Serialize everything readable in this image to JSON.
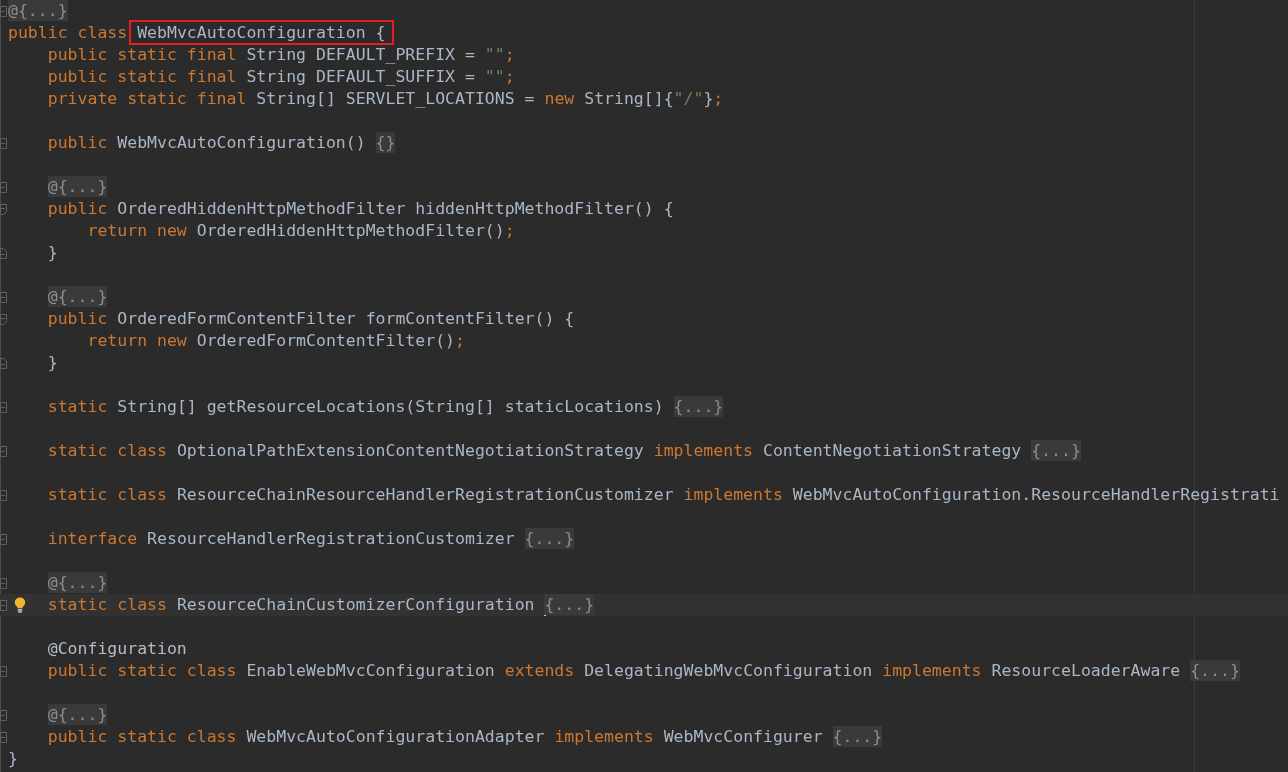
{
  "editor": {
    "lines": [
      {
        "current": false,
        "markers": [
          {
            "kind": "collapsed"
          }
        ],
        "segments": [
          {
            "kind": "fold",
            "text": "@{...}"
          }
        ]
      },
      {
        "current": false,
        "segments": [
          {
            "kind": "code",
            "tokens": [
              {
                "kind": "keyword",
                "text": "public class"
              }
            ]
          },
          {
            "kind": "marked",
            "tokens": [
              {
                "kind": "name",
                "text": "WebMvcAutoConfiguration {"
              }
            ]
          }
        ],
        "children": [
          {
            "current": false,
            "segments": [
              {
                "kind": "code",
                "tokens": [
                  {
                    "kind": "keyword",
                    "text": "public static final "
                  },
                  {
                    "kind": "name",
                    "text": "String DEFAULT_PREFIX = "
                  },
                  {
                    "kind": "string",
                    "text": "\"\""
                  },
                  {
                    "kind": "punct",
                    "text": ";"
                  }
                ]
              }
            ]
          },
          {
            "current": false,
            "segments": [
              {
                "kind": "code",
                "tokens": [
                  {
                    "kind": "keyword",
                    "text": "public static final "
                  },
                  {
                    "kind": "name",
                    "text": "String DEFAULT_SUFFIX = "
                  },
                  {
                    "kind": "string",
                    "text": "\"\""
                  },
                  {
                    "kind": "punct",
                    "text": ";"
                  }
                ]
              }
            ]
          },
          {
            "current": false,
            "segments": [
              {
                "kind": "code",
                "tokens": [
                  {
                    "kind": "keyword",
                    "text": "private static final "
                  },
                  {
                    "kind": "name",
                    "text": "String[] SERVLET_LOCATIONS = "
                  },
                  {
                    "kind": "keyword",
                    "text": "new "
                  },
                  {
                    "kind": "name",
                    "text": "String[]{"
                  },
                  {
                    "kind": "string",
                    "text": "\"/\""
                  },
                  {
                    "kind": "name",
                    "text": "}"
                  },
                  {
                    "kind": "punct",
                    "text": ";"
                  }
                ]
              }
            ]
          },
          {
            "current": false
          },
          {
            "current": false,
            "markers": [
              {
                "kind": "collapsed"
              }
            ],
            "segments": [
              {
                "kind": "code",
                "tokens": [
                  {
                    "kind": "keyword",
                    "text": "public "
                  },
                  {
                    "kind": "name",
                    "text": "WebMvcAutoConfiguration()"
                  }
                ]
              },
              {
                "kind": "fold",
                "text": "{}"
              }
            ]
          },
          {
            "current": false
          },
          {
            "current": false,
            "markers": [
              {
                "kind": "collapsed"
              }
            ],
            "segments": [
              {
                "kind": "fold",
                "text": "@{...}"
              }
            ]
          },
          {
            "current": false,
            "markers": [
              {
                "kind": "open"
              }
            ],
            "segments": [
              {
                "kind": "code",
                "tokens": [
                  {
                    "kind": "keyword",
                    "text": "public "
                  },
                  {
                    "kind": "name",
                    "text": "OrderedHiddenHttpMethodFilter hiddenHttpMethodFilter() {"
                  }
                ]
              }
            ],
            "children": [
              {
                "current": false,
                "segments": [
                  {
                    "kind": "code",
                    "tokens": [
                      {
                        "kind": "keyword",
                        "text": "return new "
                      },
                      {
                        "kind": "name",
                        "text": "OrderedHiddenHttpMethodFilter()"
                      },
                      {
                        "kind": "punct",
                        "text": ";"
                      }
                    ]
                  }
                ]
              }
            ]
          },
          {
            "current": false,
            "markers": [
              {
                "kind": "close"
              }
            ],
            "segments": [
              {
                "kind": "code",
                "tokens": [
                  {
                    "kind": "name",
                    "text": "}"
                  }
                ]
              }
            ]
          },
          {
            "current": false
          },
          {
            "current": false,
            "markers": [
              {
                "kind": "collapsed"
              }
            ],
            "segments": [
              {
                "kind": "fold",
                "text": "@{...}"
              }
            ]
          },
          {
            "current": false,
            "markers": [
              {
                "kind": "open"
              }
            ],
            "segments": [
              {
                "kind": "code",
                "tokens": [
                  {
                    "kind": "keyword",
                    "text": "public "
                  },
                  {
                    "kind": "name",
                    "text": "OrderedFormContentFilter formContentFilter() {"
                  }
                ]
              }
            ],
            "children": [
              {
                "current": false,
                "segments": [
                  {
                    "kind": "code",
                    "tokens": [
                      {
                        "kind": "keyword",
                        "text": "return new "
                      },
                      {
                        "kind": "name",
                        "text": "OrderedFormContentFilter()"
                      },
                      {
                        "kind": "punct",
                        "text": ";"
                      }
                    ]
                  }
                ]
              }
            ]
          },
          {
            "current": false,
            "markers": [
              {
                "kind": "close"
              }
            ],
            "segments": [
              {
                "kind": "code",
                "tokens": [
                  {
                    "kind": "name",
                    "text": "}"
                  }
                ]
              }
            ]
          },
          {
            "current": false
          },
          {
            "current": false,
            "markers": [
              {
                "kind": "collapsed"
              }
            ],
            "segments": [
              {
                "kind": "code",
                "tokens": [
                  {
                    "kind": "keyword",
                    "text": "static "
                  },
                  {
                    "kind": "name",
                    "text": "String[] getResourceLocations(String[] staticLocations)"
                  }
                ]
              },
              {
                "kind": "fold",
                "text": "{...}"
              }
            ]
          },
          {
            "current": false
          },
          {
            "current": false,
            "markers": [
              {
                "kind": "collapsed"
              }
            ],
            "segments": [
              {
                "kind": "code",
                "tokens": [
                  {
                    "kind": "keyword",
                    "text": "static class "
                  },
                  {
                    "kind": "name",
                    "text": "OptionalPathExtensionContentNegotiationStrategy "
                  },
                  {
                    "kind": "keyword",
                    "text": "implements "
                  },
                  {
                    "kind": "name",
                    "text": "ContentNegotiationStrategy"
                  }
                ]
              },
              {
                "kind": "fold",
                "text": "{...}"
              }
            ]
          },
          {
            "current": false
          },
          {
            "current": false,
            "markers": [
              {
                "kind": "collapsed"
              }
            ],
            "segments": [
              {
                "kind": "code",
                "tokens": [
                  {
                    "kind": "keyword",
                    "text": "static class "
                  },
                  {
                    "kind": "name",
                    "text": "ResourceChainResourceHandlerRegistrationCustomizer "
                  },
                  {
                    "kind": "keyword",
                    "text": "implements "
                  },
                  {
                    "kind": "name",
                    "text": "WebMvcAutoConfiguration.ResourceHandlerRegistrati"
                  }
                ]
              }
            ]
          },
          {
            "current": false
          },
          {
            "current": false,
            "markers": [
              {
                "kind": "collapsed"
              }
            ],
            "segments": [
              {
                "kind": "code",
                "tokens": [
                  {
                    "kind": "keyword",
                    "text": "interface "
                  },
                  {
                    "kind": "name",
                    "text": "ResourceHandlerRegistrationCustomizer"
                  }
                ]
              },
              {
                "kind": "fold",
                "text": "{...}"
              }
            ]
          },
          {
            "current": false
          },
          {
            "current": false,
            "markers": [
              {
                "kind": "collapsed"
              }
            ],
            "segments": [
              {
                "kind": "fold",
                "text": "@{...}"
              }
            ]
          },
          {
            "current": true,
            "markers": [
              {
                "kind": "intention"
              },
              {
                "kind": "collapsed"
              }
            ],
            "segments": [
              {
                "kind": "code",
                "tokens": [
                  {
                    "kind": "keyword",
                    "text": "static class "
                  },
                  {
                    "kind": "name",
                    "text": "ResourceChainCustomizerConfiguration"
                  }
                ]
              },
              {
                "kind": "caret"
              },
              {
                "kind": "fold",
                "text": "{...}"
              }
            ]
          },
          {
            "current": false
          },
          {
            "current": false,
            "segments": [
              {
                "kind": "code",
                "tokens": [
                  {
                    "kind": "annotation",
                    "text": "@Configuration"
                  }
                ]
              }
            ]
          },
          {
            "current": false,
            "markers": [
              {
                "kind": "collapsed"
              }
            ],
            "segments": [
              {
                "kind": "code",
                "tokens": [
                  {
                    "kind": "keyword",
                    "text": "public static class "
                  },
                  {
                    "kind": "name",
                    "text": "EnableWebMvcConfiguration "
                  },
                  {
                    "kind": "keyword",
                    "text": "extends "
                  },
                  {
                    "kind": "name",
                    "text": "DelegatingWebMvcConfiguration "
                  },
                  {
                    "kind": "keyword",
                    "text": "implements "
                  },
                  {
                    "kind": "name",
                    "text": "ResourceLoaderAware"
                  }
                ]
              },
              {
                "kind": "fold",
                "text": "{...}"
              }
            ]
          },
          {
            "current": false
          },
          {
            "current": false,
            "markers": [
              {
                "kind": "collapsed"
              }
            ],
            "segments": [
              {
                "kind": "fold",
                "text": "@{...}"
              }
            ]
          },
          {
            "current": false,
            "markers": [
              {
                "kind": "collapsed"
              }
            ],
            "segments": [
              {
                "kind": "code",
                "tokens": [
                  {
                    "kind": "keyword",
                    "text": "public static class "
                  },
                  {
                    "kind": "name",
                    "text": "WebMvcAutoConfigurationAdapter "
                  },
                  {
                    "kind": "keyword",
                    "text": "implements "
                  },
                  {
                    "kind": "name",
                    "text": "WebMvcConfigurer"
                  }
                ]
              },
              {
                "kind": "fold",
                "text": "{...}"
              }
            ]
          }
        ]
      },
      {
        "current": false,
        "segments": [
          {
            "kind": "code",
            "tokens": [
              {
                "kind": "name",
                "text": "}"
              }
            ]
          }
        ]
      }
    ]
  }
}
